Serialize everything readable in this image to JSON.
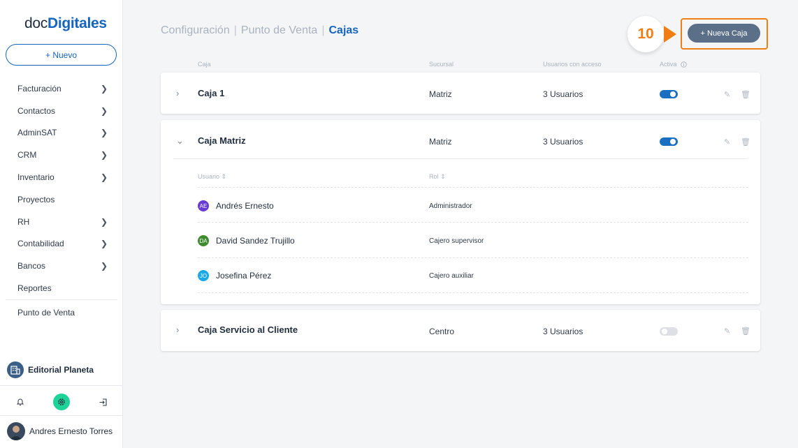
{
  "app": {
    "logo_prefix": "doc",
    "logo_brand": "Digitales",
    "new_button": "+ Nuevo"
  },
  "sidebar": {
    "items": [
      {
        "label": "Facturación",
        "has_submenu": true
      },
      {
        "label": "Contactos",
        "has_submenu": true
      },
      {
        "label": "AdminSAT",
        "has_submenu": true
      },
      {
        "label": "CRM",
        "has_submenu": true
      },
      {
        "label": "Inventario",
        "has_submenu": true
      },
      {
        "label": "Proyectos",
        "has_submenu": false
      },
      {
        "label": "RH",
        "has_submenu": true
      },
      {
        "label": "Contabilidad",
        "has_submenu": true
      },
      {
        "label": "Bancos",
        "has_submenu": true
      },
      {
        "label": "Reportes",
        "has_submenu": false
      }
    ],
    "punto_venta": "Punto de Venta",
    "company": "Editorial Planeta",
    "user": "Andres Ernesto Torres"
  },
  "breadcrumb": {
    "level1": "Configuración",
    "level2": "Punto de Venta",
    "current": "Cajas"
  },
  "tutorial": {
    "step": "10"
  },
  "actions": {
    "new_caja": "+ Nueva Caja"
  },
  "table": {
    "headers": {
      "caja": "Caja",
      "sucursal": "Sucursal",
      "usuarios": "Usuarios con acceso",
      "activa": "Activa"
    },
    "rows": [
      {
        "name": "Caja 1",
        "sucursal": "Matriz",
        "usuarios": "3 Usuarios",
        "activa": true,
        "expanded": false
      },
      {
        "name": "Caja Matriz",
        "sucursal": "Matriz",
        "usuarios": "3 Usuarios",
        "activa": true,
        "expanded": true
      },
      {
        "name": "Caja Servicio al Cliente",
        "sucursal": "Centro",
        "usuarios": "3 Usuarios",
        "activa": false,
        "expanded": false
      }
    ]
  },
  "subtable": {
    "headers": {
      "usuario": "Usuario",
      "rol": "Rol"
    },
    "users": [
      {
        "initials": "AE",
        "name": "Andrés Ernesto",
        "rol": "Administrador",
        "color": "#6a3bd2"
      },
      {
        "initials": "DA",
        "name": "David Sandez Trujillo",
        "rol": "Cajero supervisor",
        "color": "#3f8a2f"
      },
      {
        "initials": "JO",
        "name": "Josefina Pérez",
        "rol": "Cajero auxiliar",
        "color": "#1aa9e8"
      }
    ]
  },
  "colors": {
    "accent": "#1565c0",
    "tutorial": "#f07e15",
    "toggle_on": "#1a6fc0"
  }
}
